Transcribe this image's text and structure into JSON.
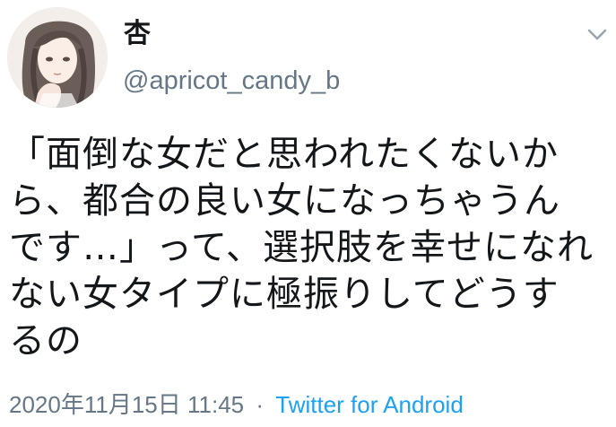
{
  "author": {
    "display_name": "杏",
    "handle": "@apricot_candy_b",
    "avatar_icon": "avatar-illustration"
  },
  "tweet": {
    "lines": [
      "「面倒な女だと思われたくないか",
      "ら、都合の良い女になっちゃうん",
      "です…」って、選択肢を幸せになれ",
      "ない女タイプに極振りしてどうす",
      "るの"
    ]
  },
  "meta": {
    "timestamp": "2020年11月15日 11:45",
    "separator": "·",
    "source": "Twitter for Android"
  },
  "colors": {
    "text": "#14171a",
    "secondary": "#657786",
    "link": "#1da1f2"
  },
  "icons": {
    "menu": "chevron-down-icon"
  }
}
